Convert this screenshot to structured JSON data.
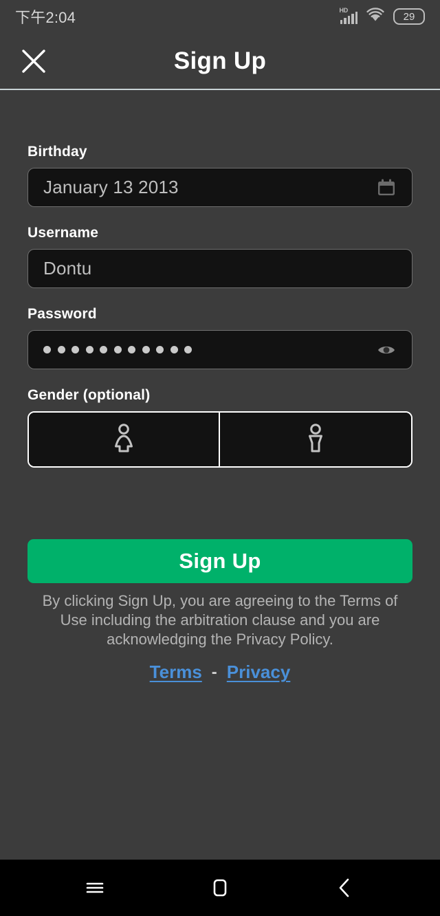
{
  "statusbar": {
    "time": "下午2:04",
    "network_label": "HD",
    "battery_level": "29",
    "signal_icon": "cellular-signal-icon",
    "wifi_icon": "wifi-icon",
    "battery_icon": "battery-icon"
  },
  "header": {
    "title": "Sign Up",
    "close_icon": "close-icon"
  },
  "form": {
    "birthday": {
      "label": "Birthday",
      "value": "January 13 2013",
      "icon": "calendar-icon"
    },
    "username": {
      "label": "Username",
      "value": "Dontu"
    },
    "password": {
      "label": "Password",
      "value": "•••••••••••",
      "masked_char_count": 11,
      "toggle_icon": "eye-icon"
    },
    "gender": {
      "label": "Gender (optional)",
      "options": [
        {
          "name": "female",
          "icon": "female-figure-icon"
        },
        {
          "name": "male",
          "icon": "male-figure-icon"
        }
      ]
    }
  },
  "actions": {
    "signup_label": "Sign Up",
    "disclaimer": "By clicking Sign Up, you are agreeing to the Terms of Use including the arbitration clause and you are acknowledging the Privacy Policy.",
    "terms_link": "Terms",
    "link_separator": "-",
    "privacy_link": "Privacy"
  },
  "navbar": {
    "recents_icon": "recents-menu-icon",
    "home_icon": "home-icon",
    "back_icon": "back-chevron-icon"
  },
  "colors": {
    "background": "#3c3c3c",
    "input_fill": "#121212",
    "accent_green": "#00b16a",
    "link_blue": "#4a90d9"
  }
}
